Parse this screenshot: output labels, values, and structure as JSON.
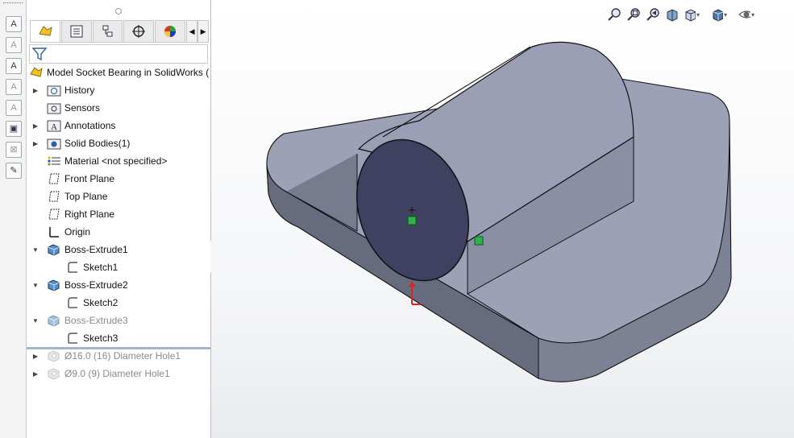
{
  "app": {
    "name": "SolidWorks"
  },
  "feature_manager": {
    "root_label": "Model Socket Bearing in SolidWorks  (",
    "tabs": [
      {
        "name": "featuremanager-tab",
        "icon": "feature-tree-icon"
      },
      {
        "name": "propertymanager-tab",
        "icon": "property-manager-icon"
      },
      {
        "name": "configurationmanager-tab",
        "icon": "configuration-icon"
      },
      {
        "name": "dimxpert-tab",
        "icon": "crosshair-icon"
      },
      {
        "name": "display-manager-tab",
        "icon": "color-wheel-icon"
      }
    ],
    "items": [
      {
        "label": "History",
        "icon": "history-folder-icon",
        "expandable": true,
        "expanded": false,
        "indent": 0
      },
      {
        "label": "Sensors",
        "icon": "sensors-folder-icon",
        "expandable": false,
        "indent": 0
      },
      {
        "label": "Annotations",
        "icon": "annotations-folder-icon",
        "expandable": true,
        "expanded": false,
        "indent": 0
      },
      {
        "label": "Solid Bodies(1)",
        "icon": "solid-bodies-folder-icon",
        "expandable": true,
        "expanded": false,
        "indent": 0
      },
      {
        "label": "Material <not specified>",
        "icon": "material-icon",
        "expandable": false,
        "indent": 0
      },
      {
        "label": "Front Plane",
        "icon": "plane-icon",
        "expandable": false,
        "indent": 0
      },
      {
        "label": "Top Plane",
        "icon": "plane-icon",
        "expandable": false,
        "indent": 0
      },
      {
        "label": "Right Plane",
        "icon": "plane-icon",
        "expandable": false,
        "indent": 0
      },
      {
        "label": "Origin",
        "icon": "origin-icon",
        "expandable": false,
        "indent": 0
      },
      {
        "label": "Boss-Extrude1",
        "icon": "extrude-icon",
        "expandable": true,
        "expanded": true,
        "indent": 0
      },
      {
        "label": "Sketch1",
        "icon": "sketch-icon",
        "expandable": false,
        "indent": 1
      },
      {
        "label": "Boss-Extrude2",
        "icon": "extrude-icon",
        "expandable": true,
        "expanded": true,
        "indent": 0
      },
      {
        "label": "Sketch2",
        "icon": "sketch-icon",
        "expandable": false,
        "indent": 1
      },
      {
        "label": "Boss-Extrude3",
        "icon": "extrude-icon",
        "expandable": true,
        "expanded": true,
        "indent": 0,
        "dimmed": true
      },
      {
        "label": "Sketch3",
        "icon": "sketch-icon",
        "expandable": false,
        "indent": 1
      },
      {
        "label": "Ø16.0 (16) Diameter Hole1",
        "icon": "hole-wizard-icon",
        "expandable": true,
        "expanded": false,
        "indent": 0,
        "dimmed": true
      },
      {
        "label": "Ø9.0 (9) Diameter Hole1",
        "icon": "hole-wizard-icon",
        "expandable": true,
        "expanded": false,
        "indent": 0,
        "dimmed": true
      }
    ]
  },
  "heads_up_toolbar": [
    {
      "name": "zoom-to-fit-button",
      "icon": "zoom-to-fit-icon"
    },
    {
      "name": "zoom-to-area-button",
      "icon": "zoom-to-area-icon"
    },
    {
      "name": "previous-view-button",
      "icon": "previous-view-icon"
    },
    {
      "name": "section-view-button",
      "icon": "section-view-icon"
    },
    {
      "name": "view-orientation-button",
      "icon": "view-orientation-icon",
      "dropdown": true
    },
    {
      "name": "display-style-button",
      "icon": "display-style-icon",
      "dropdown": true
    },
    {
      "name": "hide-show-items-button",
      "icon": "eye-icon",
      "dropdown": true
    }
  ],
  "colors": {
    "model_top": "#9a9fb4",
    "model_side": "#6a6f82",
    "model_dark_face": "#3d3f5c",
    "accent_green": "#2db34a",
    "origin_red": "#e02020"
  }
}
